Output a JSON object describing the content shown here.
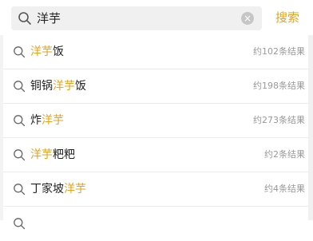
{
  "search": {
    "query": "洋芋",
    "clear_label": "×",
    "submit_label": "搜索"
  },
  "results": [
    {
      "before": "",
      "highlight": "洋芋",
      "after": "饭",
      "count": "约102条结果"
    },
    {
      "before": "铜锅",
      "highlight": "洋芋",
      "after": "饭",
      "count": "约198条结果"
    },
    {
      "before": "炸",
      "highlight": "洋芋",
      "after": "",
      "count": "约273条结果"
    },
    {
      "before": "",
      "highlight": "洋芋",
      "after": "粑粑",
      "count": "约2条结果"
    },
    {
      "before": "丁家坡",
      "highlight": "洋芋",
      "after": "",
      "count": "约4条结果"
    }
  ],
  "colors": {
    "highlight": "#e8a218",
    "muted": "#999999"
  },
  "icons": {
    "search": "search-icon",
    "clear": "clear-icon",
    "row": "search-icon"
  }
}
